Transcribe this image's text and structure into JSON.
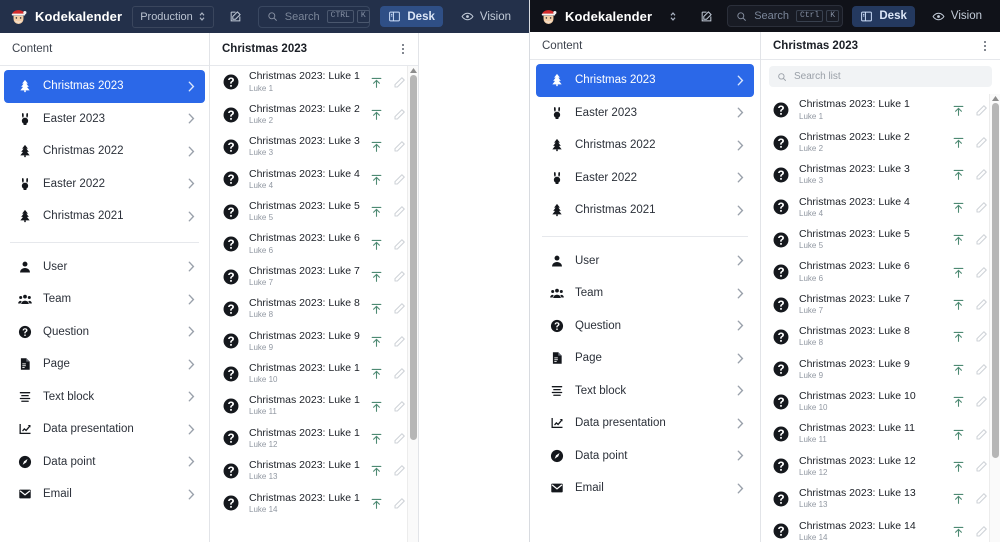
{
  "app": {
    "brand": "Kodekalender",
    "logo_icon": "santa-face-icon",
    "dataset_label": "Production",
    "dataset_icon": "chevron-up-down-icon",
    "compose_icon": "compose-icon",
    "search_icon": "search-icon",
    "search_placeholder": "Search",
    "shortcut_keys": [
      "CTRL",
      "K"
    ],
    "shortcut_keys_right": [
      "Ctrl",
      "K"
    ],
    "nav_buttons": [
      {
        "label": "Desk",
        "icon": "desk-icon",
        "active": true
      },
      {
        "label": "Vision",
        "icon": "eye-icon",
        "active": false
      }
    ],
    "colors": {
      "navbar_left_bg": "#23304a",
      "navbar_right_bg": "#101219",
      "accent_selected": "#2b68e8",
      "nav_pill_active_left": "#2f4f86",
      "nav_pill_active_right": "#24395f",
      "publish_icon_green": "#3f7a63",
      "edit_icon_gray": "#c8ccd2"
    }
  },
  "content_pane": {
    "title": "Content",
    "items": [
      {
        "label": "Christmas 2023",
        "icon": "christmas-tree-icon",
        "selected": true
      },
      {
        "label": "Easter 2023",
        "icon": "rabbit-icon",
        "selected": false
      },
      {
        "label": "Christmas 2022",
        "icon": "christmas-tree-icon",
        "selected": false
      },
      {
        "label": "Easter 2022",
        "icon": "rabbit-icon",
        "selected": false
      },
      {
        "label": "Christmas 2021",
        "icon": "christmas-tree-icon",
        "selected": false
      }
    ],
    "items2": [
      {
        "label": "User",
        "icon": "user-icon"
      },
      {
        "label": "Team",
        "icon": "team-icon"
      },
      {
        "label": "Question",
        "icon": "question-mark-icon"
      },
      {
        "label": "Page",
        "icon": "page-icon"
      },
      {
        "label": "Text block",
        "icon": "text-block-icon"
      },
      {
        "label": "Data presentation",
        "icon": "chart-icon"
      },
      {
        "label": "Data point",
        "icon": "gauge-icon"
      },
      {
        "label": "Email",
        "icon": "envelope-icon"
      }
    ]
  },
  "list_pane": {
    "title": "Christmas 2023",
    "menu_icon": "more-vertical-icon",
    "search_icon": "search-icon",
    "search_placeholder": "Search list",
    "row_icon": "question-mark-icon",
    "publish_icon": "publish-up-icon",
    "edit_icon": "pencil-icon",
    "documents": [
      {
        "title": "Christmas 2023: Luke 1",
        "subtitle": "Luke 1"
      },
      {
        "title": "Christmas 2023: Luke 2",
        "subtitle": "Luke 2"
      },
      {
        "title": "Christmas 2023: Luke 3",
        "subtitle": "Luke 3"
      },
      {
        "title": "Christmas 2023: Luke 4",
        "subtitle": "Luke 4"
      },
      {
        "title": "Christmas 2023: Luke 5",
        "subtitle": "Luke 5"
      },
      {
        "title": "Christmas 2023: Luke 6",
        "subtitle": "Luke 6"
      },
      {
        "title": "Christmas 2023: Luke 7",
        "subtitle": "Luke 7"
      },
      {
        "title": "Christmas 2023: Luke 8",
        "subtitle": "Luke 8"
      },
      {
        "title": "Christmas 2023: Luke 9",
        "subtitle": "Luke 9"
      },
      {
        "title": "Christmas 2023: Luke 10",
        "subtitle": "Luke 10"
      },
      {
        "title": "Christmas 2023: Luke 11",
        "subtitle": "Luke 11"
      },
      {
        "title": "Christmas 2023: Luke 12",
        "subtitle": "Luke 12"
      },
      {
        "title": "Christmas 2023: Luke 13",
        "subtitle": "Luke 13"
      },
      {
        "title": "Christmas 2023: Luke 14",
        "subtitle": "Luke 14"
      }
    ]
  }
}
